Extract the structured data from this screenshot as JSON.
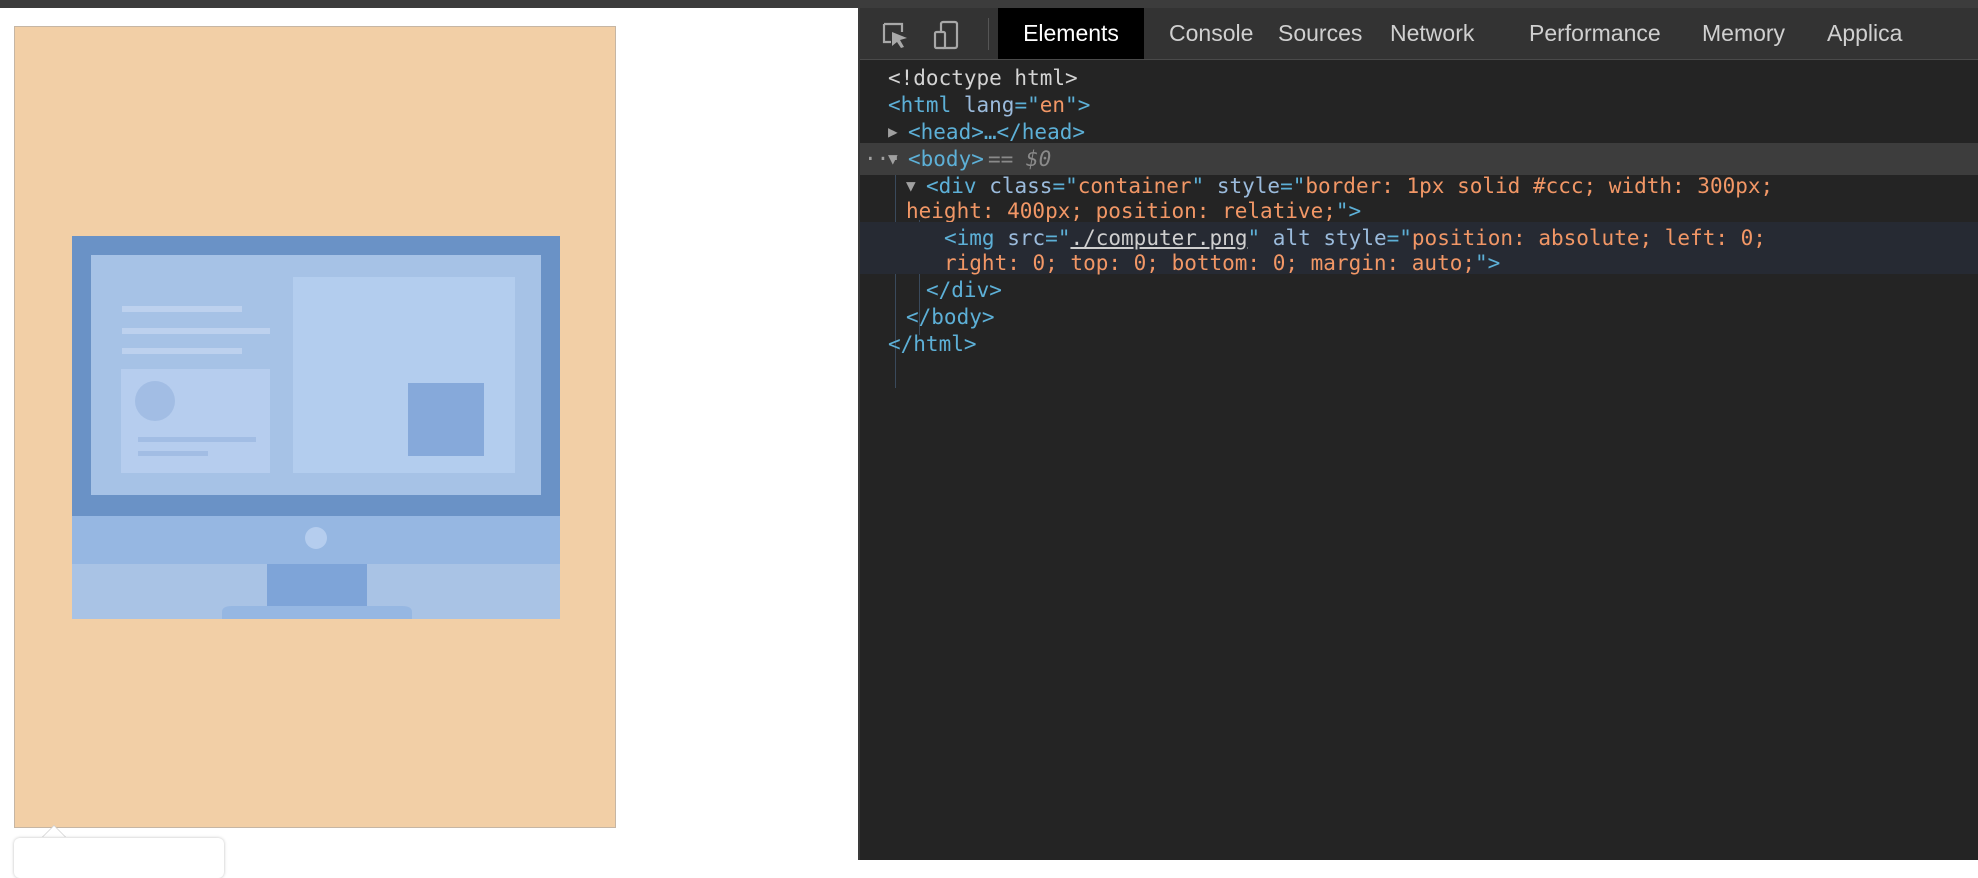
{
  "preview": {
    "container_color": "#f2cfa6",
    "image_name": "computer-illustration"
  },
  "devtools": {
    "tabs": [
      "Elements",
      "Console",
      "Sources",
      "Network",
      "Performance",
      "Memory",
      "Applica"
    ],
    "active_tab": "Elements",
    "dom": {
      "doctype": "<!doctype html>",
      "html_open_tag": "<html",
      "html_lang_attr": "lang",
      "html_lang_value": "en",
      "html_open_end": ">",
      "head": "<head>…</head>",
      "body_tag": "<body>",
      "body_marker": "== $0",
      "div_tag": "<div",
      "div_class_attr": "class",
      "div_class_value": "container",
      "div_style_attr": "style",
      "div_style_value_part1": "border: 1px solid #ccc; width: 300px;",
      "div_style_value_part2": "height: 400px; position: relative;",
      "div_end": ">",
      "img_tag": "<img",
      "img_src_attr": "src",
      "img_src_value": "./computer.png",
      "img_alt_attr": "alt",
      "img_style_attr": "style",
      "img_style_value_part1": "position: absolute; left: 0;",
      "img_style_value_part2": "right: 0; top: 0; bottom: 0; margin: auto;",
      "img_end": ">",
      "div_close": "</div>",
      "body_close": "</body>",
      "html_close": "</html>"
    }
  }
}
